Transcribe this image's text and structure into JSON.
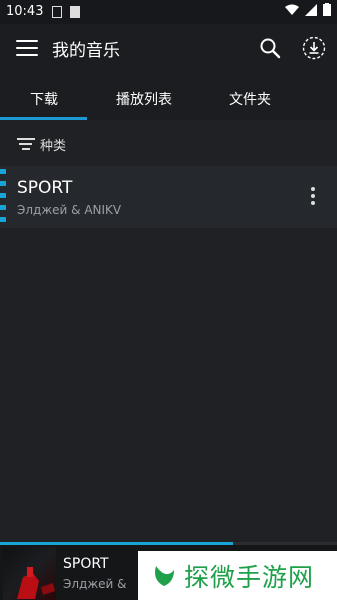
{
  "status_bar": {
    "time": "10:43"
  },
  "app_bar": {
    "title": "我的音乐"
  },
  "tabs": [
    {
      "label": "下载",
      "active": true
    },
    {
      "label": "播放列表",
      "active": false
    },
    {
      "label": "文件夹",
      "active": false
    }
  ],
  "filter": {
    "label": "种类"
  },
  "songs": [
    {
      "title": "SPORT",
      "artist": "Элджей  &  ANIKV"
    }
  ],
  "player": {
    "title": "SPORT",
    "artist": "Элджей  &",
    "progress": 0.69
  },
  "watermark": {
    "text": "探微手游网"
  },
  "colors": {
    "accent": "#1d9ad6",
    "background": "#1f2124",
    "watermark_green": "#1fa04a"
  }
}
